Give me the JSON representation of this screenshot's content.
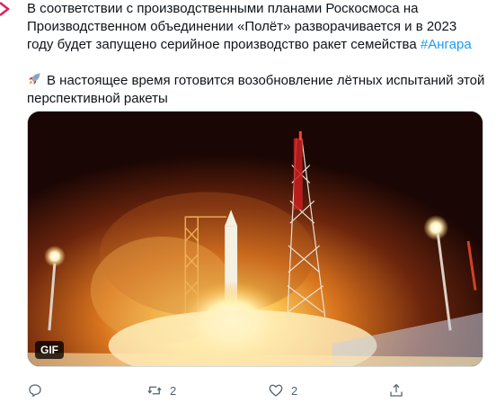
{
  "tweet": {
    "paragraph1_text": "В соответствии с производственными планами Роскосмоса на Производственном объединении «Полёт» разворачивается и в 2023 году будет запущено серийное производство ракет семейства ",
    "hashtag": "#Ангара",
    "rocket_icon": "rocket-emoji",
    "paragraph2_text": "В настоящее время готовится возобновление лётных испытаний этой перспективной ракеты",
    "media_badge": "GIF",
    "actions": {
      "reply_icon": "reply-icon",
      "retweet_icon": "retweet-icon",
      "retweet_count": "2",
      "like_icon": "like-icon",
      "like_count": "2",
      "share_icon": "share-icon"
    },
    "colors": {
      "link": "#1d9bf0",
      "text": "#0f1419",
      "muted": "#536471",
      "accent_mark": "#e0245e"
    }
  }
}
